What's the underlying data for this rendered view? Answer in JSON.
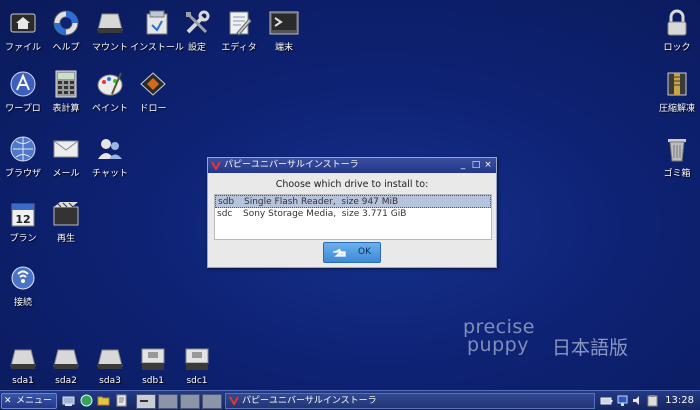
{
  "desktop": {
    "top_icons": [
      {
        "label": "ファイル",
        "icon": "home-icon"
      },
      {
        "label": "ヘルプ",
        "icon": "lifebuoy-icon"
      },
      {
        "label": "マウント",
        "icon": "drive-icon"
      },
      {
        "label": "インストール",
        "icon": "install-icon"
      },
      {
        "label": "設定",
        "icon": "tools-icon"
      },
      {
        "label": "エディタ",
        "icon": "editor-icon"
      },
      {
        "label": "端末",
        "icon": "terminal-icon"
      }
    ],
    "left_icons": [
      {
        "label": "ワープロ",
        "icon": "wordprocessor-icon"
      },
      {
        "label": "表計算",
        "icon": "calculator-icon"
      },
      {
        "label": "ペイント",
        "icon": "paint-icon"
      },
      {
        "label": "ドロー",
        "icon": "draw-icon"
      },
      {
        "label": "ブラウザ",
        "icon": "browser-icon"
      },
      {
        "label": "メール",
        "icon": "mail-icon"
      },
      {
        "label": "チャット",
        "icon": "chat-icon"
      },
      {
        "label": "プラン",
        "icon": "calendar-icon"
      },
      {
        "label": "再生",
        "icon": "media-player-icon"
      },
      {
        "label": "接続",
        "icon": "connect-icon"
      }
    ],
    "right_icons": [
      {
        "label": "ロック",
        "icon": "lock-icon"
      },
      {
        "label": "圧縮解凍",
        "icon": "archive-icon"
      },
      {
        "label": "ゴミ箱",
        "icon": "trash-icon"
      }
    ],
    "calendar_day": "12",
    "drives": [
      {
        "label": "sda1",
        "icon": "drive-icon"
      },
      {
        "label": "sda2",
        "icon": "drive-icon"
      },
      {
        "label": "sda3",
        "icon": "drive-icon"
      },
      {
        "label": "sdb1",
        "icon": "usb-drive-icon"
      },
      {
        "label": "sdc1",
        "icon": "usb-drive-icon"
      }
    ],
    "brand_line1": "precise",
    "brand_line2": "puppy",
    "brand_jp": "日本語版"
  },
  "dialog": {
    "title": "パピーユニバーサルインストーラ",
    "heading": "Choose which drive to install to:",
    "rows": [
      {
        "device": "sdb",
        "desc": "Single Flash Reader,  size 947 MiB",
        "selected": true
      },
      {
        "device": "sdc",
        "desc": "Sony Storage Media,  size 3.771 GiB",
        "selected": false
      }
    ],
    "ok_label": "OK",
    "controls": {
      "minimize": "_",
      "maximize": "□",
      "close": "×"
    }
  },
  "taskbar": {
    "menu_label": "メニュー",
    "task_title": "パピーユニバーサルインストーラ",
    "clock": "13:28"
  },
  "colors": {
    "desktop_bg": "#0e2274",
    "dialog_titlebar": "#2a3d8f",
    "selection": "#b5c3dc",
    "ok_button": "#4f9ae0"
  }
}
